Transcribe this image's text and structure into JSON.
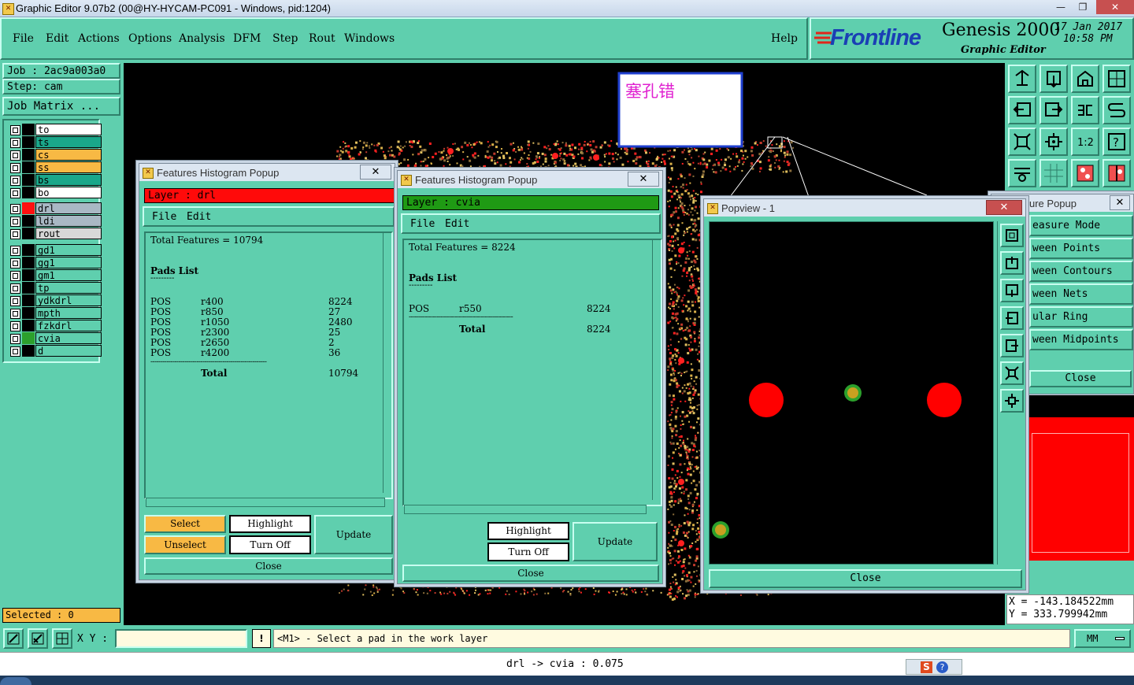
{
  "window": {
    "title": "Graphic Editor 9.07b2 (00@HY-HYCAM-PC091 - Windows, pid:1204)",
    "min": "—",
    "max": "❐",
    "close": "✕"
  },
  "menu": {
    "items": [
      "File",
      "Edit",
      "Actions",
      "Options",
      "Analysis",
      "DFM",
      "Step",
      "Rout",
      "Windows"
    ],
    "help": "Help"
  },
  "logo": {
    "brand": "Frontline",
    "product": "Genesis 2000",
    "subtitle": "Graphic Editor",
    "date": "17 Jan 2017",
    "time": "10:58 PM"
  },
  "left": {
    "job": "Job : 2ac9a003a0",
    "step": "Step: cam",
    "job_matrix": "Job Matrix ...",
    "layers": [
      {
        "name": "to",
        "bg": "#ffffff",
        "sw": "#000000"
      },
      {
        "name": "ts",
        "bg": "#1aa78a",
        "sw": "#000000"
      },
      {
        "name": "cs",
        "bg": "#f8b944",
        "sw": "#000000"
      },
      {
        "name": "ss",
        "bg": "#f8b944",
        "sw": "#000000"
      },
      {
        "name": "bs",
        "bg": "#1aa78a",
        "sw": "#000000"
      },
      {
        "name": "bo",
        "bg": "#ffffff",
        "sw": "#000000"
      },
      {
        "name": "drl",
        "bg": "#a9b8c4",
        "sw": "#ff1010"
      },
      {
        "name": "ldi",
        "bg": "#a9b8c4",
        "sw": "#000000"
      },
      {
        "name": "rout",
        "bg": "#d8d8d8",
        "sw": "#000000"
      },
      {
        "name": "gd1",
        "bg": "#5fcfae",
        "sw": "#000000"
      },
      {
        "name": "gg1",
        "bg": "#5fcfae",
        "sw": "#000000"
      },
      {
        "name": "gm1",
        "bg": "#5fcfae",
        "sw": "#000000"
      },
      {
        "name": "tp",
        "bg": "#5fcfae",
        "sw": "#000000"
      },
      {
        "name": "ydkdrl",
        "bg": "#5fcfae",
        "sw": "#000000"
      },
      {
        "name": "mpth",
        "bg": "#5fcfae",
        "sw": "#000000"
      },
      {
        "name": "fzkdrl",
        "bg": "#5fcfae",
        "sw": "#000000"
      },
      {
        "name": "cvia",
        "bg": "#5fcfae",
        "sw": "#2ca02c"
      },
      {
        "name": "d",
        "bg": "#5fcfae",
        "sw": "#000000"
      }
    ],
    "selected": "Selected : 0"
  },
  "canvas": {
    "note_text": "塞孔错"
  },
  "hist1": {
    "title": "Features Histogram Popup",
    "layer": "Layer :  drl",
    "menu_file": "File",
    "menu_edit": "Edit",
    "total": "Total Features = 10794",
    "pads_title": "Pads List",
    "underline": "---------",
    "rows": [
      {
        "type": "POS",
        "sym": "r400",
        "count": "8224"
      },
      {
        "type": "POS",
        "sym": "r850",
        "count": "27"
      },
      {
        "type": "POS",
        "sym": "r1050",
        "count": "2480"
      },
      {
        "type": "POS",
        "sym": "r2300",
        "count": "25"
      },
      {
        "type": "POS",
        "sym": "r2650",
        "count": "2"
      },
      {
        "type": "POS",
        "sym": "r4200",
        "count": "36"
      }
    ],
    "sep": "----------------------------------------------------------",
    "total_label": "Total",
    "total_value": "10794",
    "btn_select": "Select",
    "btn_unselect": "Unselect",
    "btn_highlight": "Highlight",
    "btn_turnoff": "Turn Off",
    "btn_update": "Update",
    "btn_close": "Close"
  },
  "hist2": {
    "title": "Features Histogram Popup",
    "layer": "Layer :  cvia",
    "menu_file": "File",
    "menu_edit": "Edit",
    "total": "Total Features = 8224",
    "pads_title": "Pads List",
    "underline": "---------",
    "rows": [
      {
        "type": "POS",
        "sym": "r550",
        "count": "8224"
      }
    ],
    "sep": "----------------------------------------------------",
    "total_label": "Total",
    "total_value": "8224",
    "btn_highlight": "Highlight",
    "btn_turnoff": "Turn Off",
    "btn_update": "Update",
    "btn_close": "Close"
  },
  "popview": {
    "title": "Popview - 1",
    "btn_close": "Close"
  },
  "measure": {
    "title": "ure Popup",
    "items": [
      "easure Mode",
      "ween Points",
      "ween Contours",
      "ween Nets",
      "ular Ring",
      "ween Midpoints"
    ],
    "btn_close": "Close"
  },
  "coords": {
    "x": "X  =  -143.184522mm",
    "y": "Y  =  333.799942mm"
  },
  "cmd": {
    "xy_label": "X Y :",
    "xy_value": "",
    "warn": "!",
    "prompt": "<M1> - Select a pad in the work layer",
    "unit": "MM"
  },
  "status": {
    "text": "drl -> cvia : 0.075"
  },
  "ime": {
    "s": "S",
    "help": "?"
  }
}
